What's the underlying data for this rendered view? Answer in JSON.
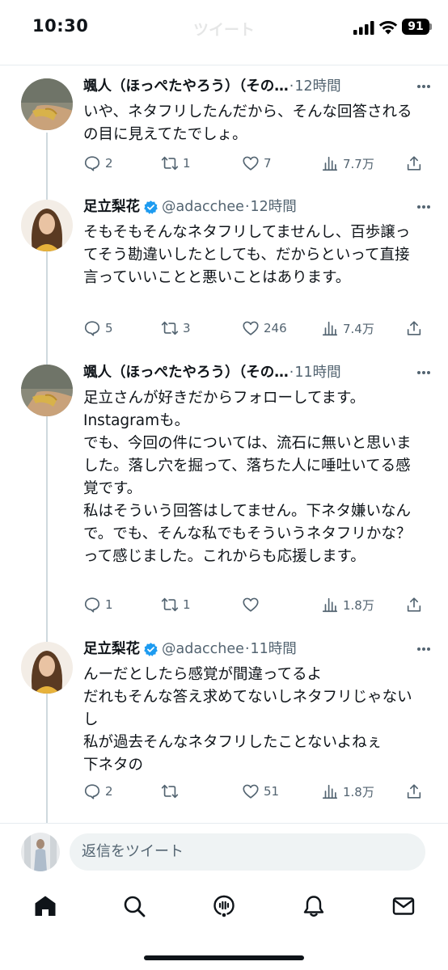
{
  "status_bar": {
    "time": "10:30",
    "battery": "91",
    "icons": [
      "signal-icon",
      "wifi-icon",
      "battery-icon"
    ]
  },
  "header": {
    "title": "ツイート"
  },
  "tweets": [
    {
      "name": "颯人（ほっぺたやろう）（その…",
      "handle": "",
      "time": "12時間",
      "verified": false,
      "text": "いや、ネタフリしたんだから、そんな回答されるの目に見えてたでしょ。",
      "replies": "2",
      "retweets": "1",
      "likes": "7",
      "views": "7.7万"
    },
    {
      "name": "足立梨花",
      "handle": "@adacchee",
      "time": "12時間",
      "verified": true,
      "text": "そもそもそんなネタフリしてませんし、百歩譲ってそう勘違いしたとしても、だからといって直接言っていいことと悪いことはあります。",
      "replies": "5",
      "retweets": "3",
      "likes": "246",
      "views": "7.4万"
    },
    {
      "name": "颯人（ほっぺたやろう）（その…",
      "handle": "",
      "time": "11時間",
      "verified": false,
      "text": "足立さんが好きだからフォローしてます。\nInstagramも。\nでも、今回の件については、流石に無いと思いました。落し穴を掘って、落ちた人に唾吐いてる感覚です。\n私はそういう回答はしてません。下ネタ嫌いなんで。でも、そんな私でもそういうネタフリかな？って感じました。これからも応援します。",
      "replies": "1",
      "retweets": "1",
      "likes": "",
      "views": "1.8万"
    },
    {
      "name": "足立梨花",
      "handle": "@adacchee",
      "time": "11時間",
      "verified": true,
      "text": "んーだとしたら感覚が間違ってるよ\nだれもそんな答え求めてないしネタフリじゃないし\n私が過去そんなネタフリしたことないよねぇ\n下ネタの",
      "replies": "2",
      "retweets": "",
      "likes": "51",
      "views": "1.8万"
    }
  ],
  "reply": {
    "placeholder": "返信をツイート"
  },
  "nav": {
    "items": [
      "home-icon",
      "search-icon",
      "spaces-icon",
      "notifications-icon",
      "messages-icon"
    ]
  },
  "colors": {
    "text": "#0f1419",
    "secondary": "#536471",
    "verified": "#1d9bf0",
    "divider": "#e6ecf0",
    "thread_line": "#cfd9de",
    "input_bg": "#eff3f4"
  }
}
